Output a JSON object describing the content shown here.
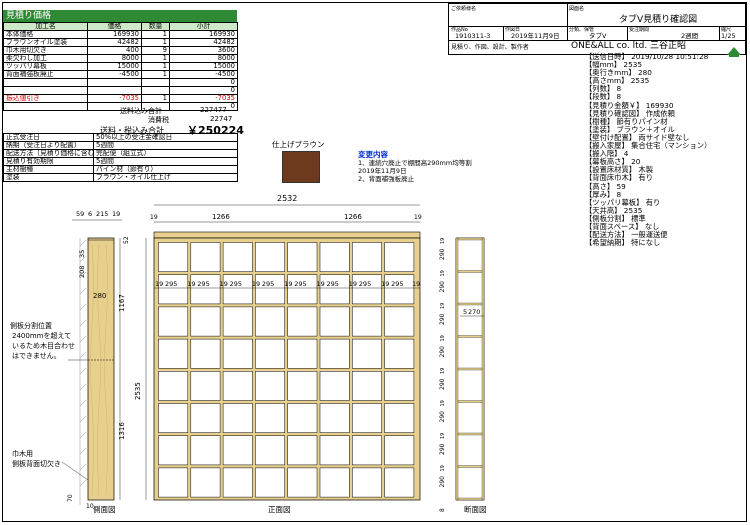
{
  "estimate": {
    "header": "見積り価格",
    "columns": [
      "加工名",
      "価格",
      "数量",
      "小計"
    ],
    "rows": [
      {
        "name": "本体価格",
        "price": "169930",
        "qty": "1",
        "sub": "169930",
        "red": false
      },
      {
        "name": "ブラウンオイル塗装",
        "price": "42482",
        "qty": "1",
        "sub": "42482",
        "red": false
      },
      {
        "name": "巾木用切欠き",
        "price": "400",
        "qty": "9",
        "sub": "3600",
        "red": false
      },
      {
        "name": "柔欠わし加工",
        "price": "8000",
        "qty": "1",
        "sub": "8000",
        "red": false
      },
      {
        "name": "ツッパリ幕板",
        "price": "15000",
        "qty": "1",
        "sub": "15000",
        "red": false
      },
      {
        "name": "背面補強板廃止",
        "price": "-4500",
        "qty": "1",
        "sub": "-4500",
        "red": false
      },
      {
        "name": "",
        "price": "",
        "qty": "",
        "sub": "0",
        "red": false
      },
      {
        "name": "",
        "price": "",
        "qty": "",
        "sub": "0",
        "red": false
      },
      {
        "name": "振込値引き",
        "price": "-7035",
        "qty": "1",
        "sub": "-7035",
        "red": true
      },
      {
        "name": "",
        "price": "",
        "qty": "",
        "sub": "0",
        "red": false
      }
    ],
    "shipping_label": "送料込み合計",
    "shipping_value": "227477",
    "tax_label": "消費税",
    "tax_value": "22747",
    "total_label": "送料・税込み合計",
    "total_value": "￥250224"
  },
  "options": [
    {
      "k": "正式受注日",
      "v": "50%以上の受注金確認日"
    },
    {
      "k": "納期（受注日より配置）",
      "v": "5週間"
    },
    {
      "k": "配送方法（見積り価格に含む）",
      "v": "完配便（組立式）"
    },
    {
      "k": "見積り有効期限",
      "v": "5週間"
    },
    {
      "k": "主材樹種",
      "v": "パイン材（節有り）"
    },
    {
      "k": "塗装",
      "v": "ブラウン・オイル仕上げ"
    }
  ],
  "finish": {
    "label": "仕上げブラウン",
    "color": "#6e3a1e"
  },
  "changes": {
    "title": "変更内容",
    "lines": [
      "1、連続穴廃止で棚間高290mm均等割",
      "2019年11月9日",
      "2、背面補強板廃止"
    ]
  },
  "titleblock": {
    "customer_label": "ご依頼様名",
    "drawing_label": "図面名",
    "drawing_name": "タブV見積り確認図",
    "work_no_label": "作品No",
    "work_no": "1910311-3",
    "date_label": "作図日",
    "date": "2019年11月9日",
    "class_label": "分類、保管",
    "class_value": "タブV",
    "delivery_label": "受注期間",
    "delivery_value": "2週間",
    "scale_label": "縮尺",
    "scale_value": "1/25",
    "note": "見積り、作図、設計、製作者",
    "company": "ONE&ALL co. ltd. 三谷正昭"
  },
  "specs": [
    "【送信日時】 2019/10/28 10:51:28",
    "【幅mm】 2535",
    "【奥行きmm】 280",
    "【高さmm】 2535",
    "【列数】 8",
    "【段数】 8",
    "【見積り金額￥】 169930",
    "【見積り確認図】 作成依頼",
    "【樹種】 節有りパイン材",
    "【塗装】 ブラウン＋オイル",
    "【壁付け配置】 両サイド壁なし",
    "【搬入家屋】 集合住宅（マンション）",
    "【搬入階】 4",
    "【幕板高さ】 20",
    "【設置床材質】 木製",
    "【背面床巾木】 有り",
    "【高さ】 59",
    "【厚み】 8",
    "【ツッパリ幕板】 有り",
    "【天井高】 2535",
    "【側板分割】 標準",
    "【背面スペース】 なし",
    "【配送方法】 一般運送便",
    "【希望納期】 特になし"
  ],
  "side": {
    "dims_top": [
      "59",
      "6",
      "215",
      "19"
    ],
    "dim_total": "2535",
    "dim_upper": "1167",
    "dim_lower": "1316",
    "dim_mid": "280",
    "dim_top_h": "35",
    "dim_top_h2": "208",
    "dim_bottom": "70",
    "dim_bottom2": "10",
    "note_split": "側板分割位置\n2400mmを超えて\nいるため木目合わせ\nはできません。",
    "note_base": "巾木用\n側板背面切欠き",
    "label": "側面図"
  },
  "front": {
    "width": "2532",
    "half1": "1266",
    "half2": "1266",
    "col_w": "295",
    "side_t": "19",
    "top_h": "52",
    "label": "正面図",
    "dim_height": "2535"
  },
  "section": {
    "label": "断面図",
    "shelf_h": "290",
    "board": "19",
    "inner": "270",
    "gap": "5",
    "base": "8",
    "base2": "5"
  }
}
